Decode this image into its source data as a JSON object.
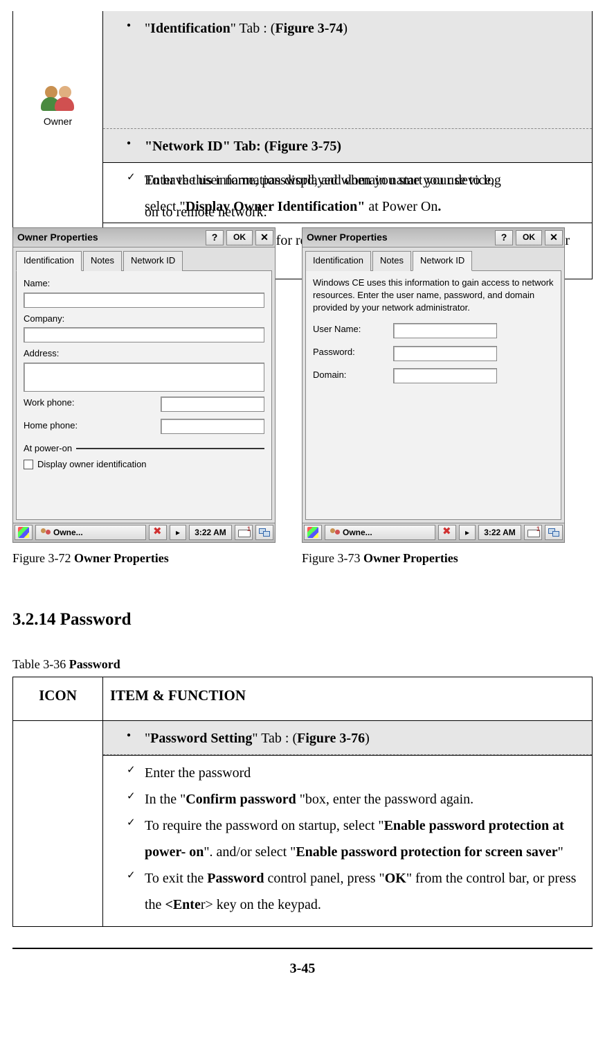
{
  "top_table": {
    "row1_text_parts": [
      "\"",
      "Identification",
      "\" Tab : (",
      "Figure 3-74",
      ")"
    ],
    "row2_text_parts": [
      "\"Network ID\" Tab: (",
      "Figure 3-75",
      ")"
    ],
    "row3a_overlap": "To have this information displayed when you start your device,",
    "row3b_overlap": "Enter the user name, password, and domain name you use to log",
    "row3c_parts": [
      "select \"",
      "Display Owner Identification\"",
      " at Power On",
      "."
    ],
    "row3c_overlap_under": "on to remote network.",
    "row4_text": "To set up identification for remote networks, see Setting up identification for remote networks.",
    "owner_caption": "Owner"
  },
  "win_left": {
    "title": "Owner Properties",
    "ok": "OK",
    "tab1": "Identification",
    "tab2": "Notes",
    "tab3": "Network ID",
    "name_lbl": "Name:",
    "company_lbl": "Company:",
    "address_lbl": "Address:",
    "workphone_lbl": "Work phone:",
    "homephone_lbl": "Home phone:",
    "poweron_lbl": "At power-on",
    "disp_lbl": "Display owner identification",
    "task_title": "Owne...",
    "time": "3:22 AM"
  },
  "win_right": {
    "title": "Owner Properties",
    "ok": "OK",
    "tab1": "Identification",
    "tab2": "Notes",
    "tab3": "Network ID",
    "desc": "Windows CE uses this information to gain access to network resources. Enter the user name, password, and domain provided by your network administrator.",
    "user_lbl": "User Name:",
    "pass_lbl": "Password:",
    "domain_lbl": "Domain:",
    "task_title": "Owne...",
    "time": "3:22 AM"
  },
  "cap_left_parts": [
    "Figure 3-72 ",
    "Owner Properties"
  ],
  "cap_right_parts": [
    "Figure 3-73 ",
    "Owner Properties"
  ],
  "section_heading": "3.2.14 Password",
  "table_caption_parts": [
    "Table 3-36 ",
    "Password"
  ],
  "pw_table": {
    "h1": "ICON",
    "h2": "ITEM & FUNCTION",
    "row_header_parts": [
      "\"",
      "Password Setting",
      "\" Tab : (",
      "Figure 3-76",
      ")"
    ],
    "b1": "Enter the password",
    "b2_parts": [
      "In the \"",
      "Confirm password",
      " \"box, enter the password again."
    ],
    "b3_parts": [
      "To require the password on startup, select \"",
      "Enable password protection at power- on",
      "\". and/or select \"",
      "Enable password protection for screen saver",
      "\""
    ],
    "b4_parts": [
      "To exit the ",
      "Password",
      " control panel, press \"",
      "OK",
      "\" from the control bar, or press the ",
      "<Ente",
      "r>",
      " key on the keypad."
    ]
  },
  "page_num": "3-45"
}
